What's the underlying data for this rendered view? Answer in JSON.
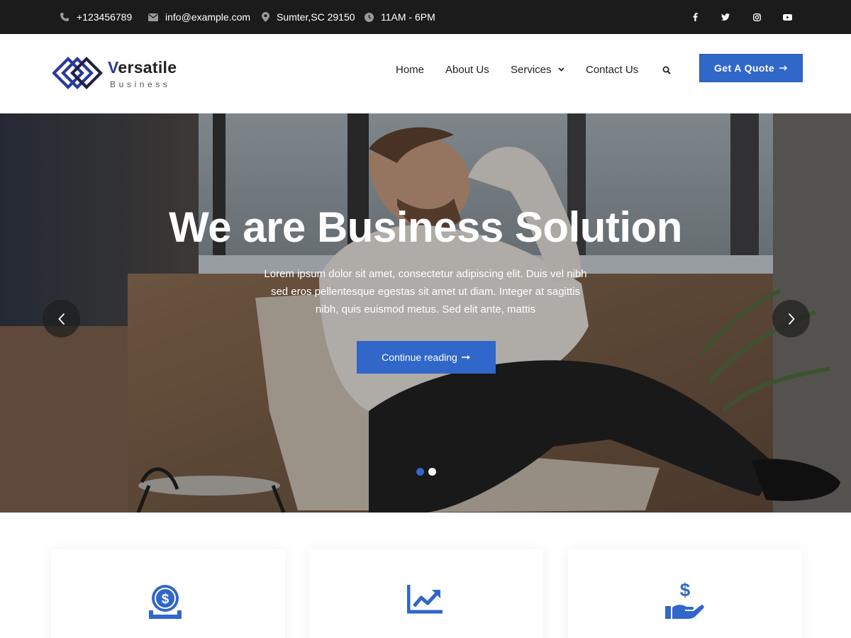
{
  "topbar": {
    "phone": "+123456789",
    "email": "info@example.com",
    "location": "Sumter,SC 29150",
    "hours": "11AM - 6PM",
    "socials": [
      "facebook-icon",
      "twitter-icon",
      "instagram-icon",
      "youtube-icon"
    ]
  },
  "header": {
    "logo_first": "V",
    "logo_rest": "ersatile",
    "logo_sub": "Business",
    "nav": [
      "Home",
      "About Us",
      "Services",
      "Contact Us"
    ],
    "cta": "Get A Quote"
  },
  "hero": {
    "title": "We are Business Solution",
    "text": "Lorem ipsum dolor sit amet, consectetur adipiscing elit. Duis vel nibh sed eros pellentesque egestas sit amet ut diam. Integer at sagittis nibh, quis euismod metus. Sed elit ante, mattis",
    "cta": "Continue reading",
    "slides": 2,
    "active_slide": 1
  },
  "features": {
    "icons": [
      "dollar-coin-icon",
      "chart-trend-icon",
      "dollar-hand-icon"
    ]
  },
  "colors": {
    "accent": "#3067c8",
    "topbar": "#1b1b1b",
    "logo_blue": "#2b3a9e"
  }
}
